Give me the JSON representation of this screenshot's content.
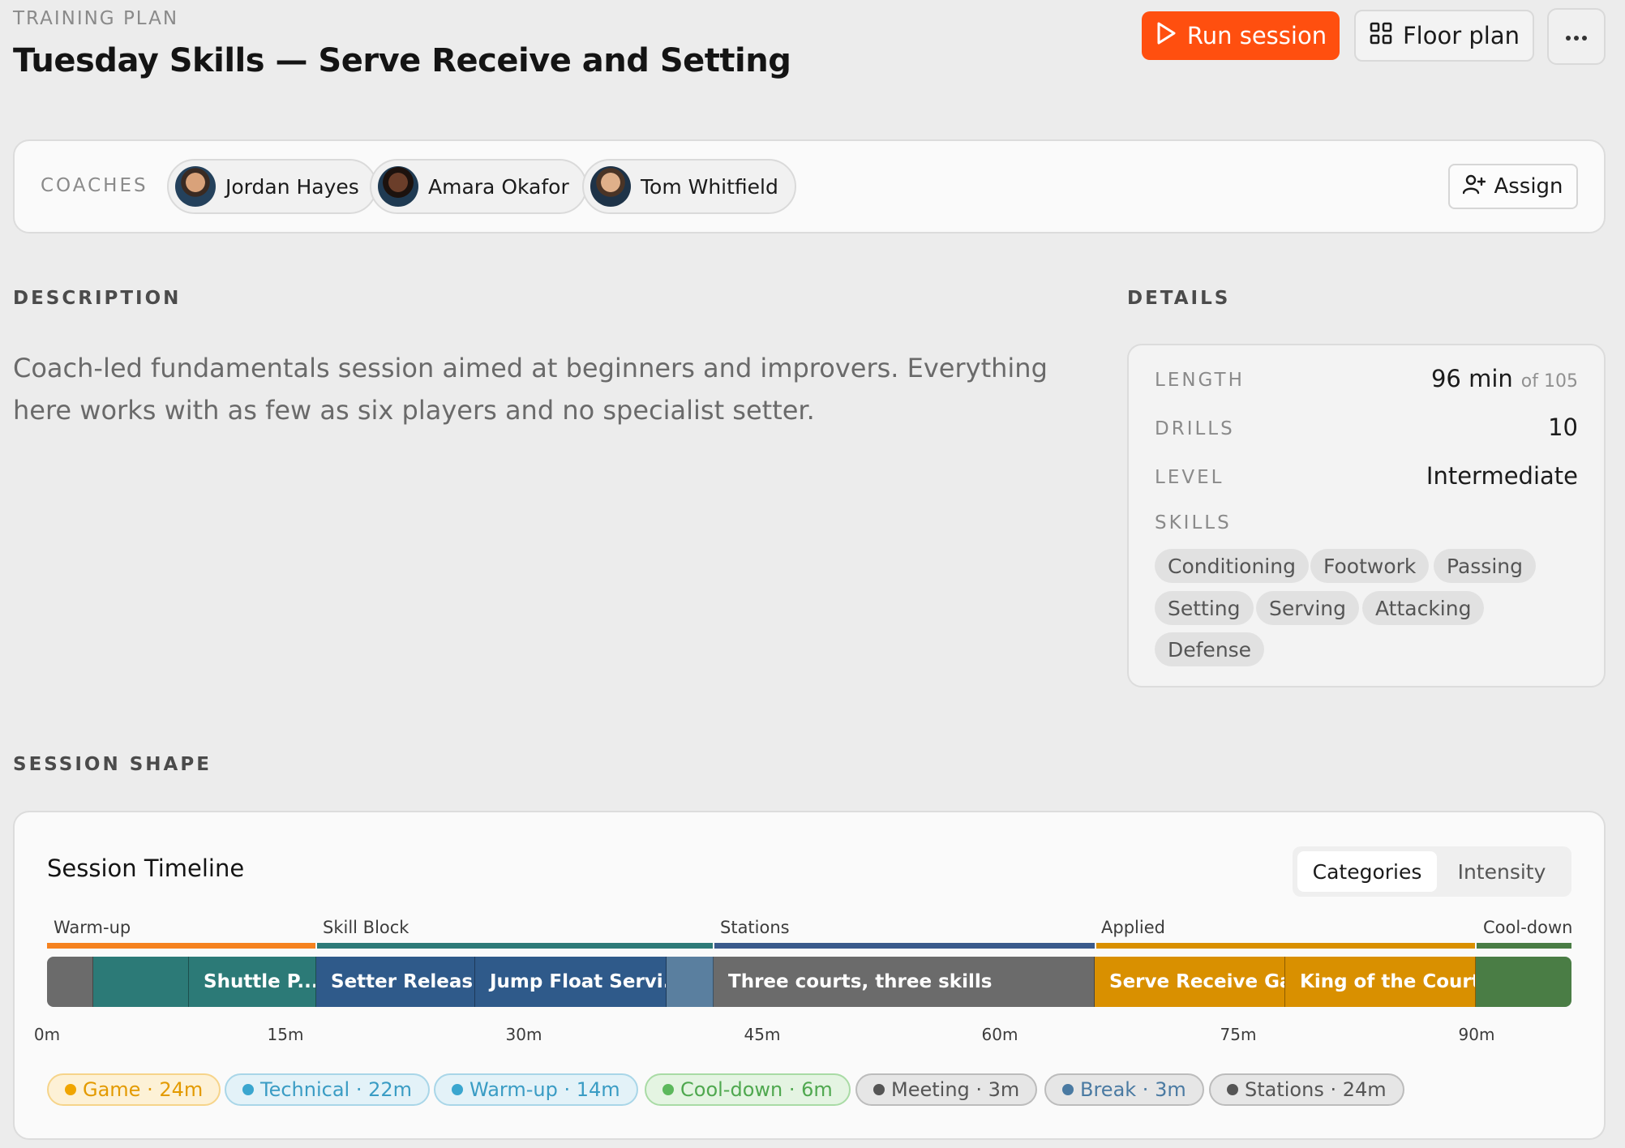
{
  "header": {
    "eyebrow": "TRAINING PLAN",
    "title": "Tuesday Skills — Serve Receive and Setting",
    "run_label": "Run session",
    "floor_label": "Floor plan",
    "more_icon": "more-horizontal-icon"
  },
  "coaches": {
    "label": "COACHES",
    "list": [
      {
        "name": "Jordan Hayes"
      },
      {
        "name": "Amara Okafor"
      },
      {
        "name": "Tom Whitfield"
      }
    ],
    "assign_label": "Assign"
  },
  "description": {
    "label": "DESCRIPTION",
    "text": "Coach-led fundamentals session aimed at beginners and improvers. Everything here works with as few as six players and no specialist setter."
  },
  "details": {
    "label": "DETAILS",
    "length_label": "LENGTH",
    "length_value": "96 min",
    "length_of": "of 105",
    "drills_label": "DRILLS",
    "drills_value": "10",
    "level_label": "LEVEL",
    "level_value": "Intermediate",
    "skills_label": "SKILLS",
    "skills": [
      "Conditioning",
      "Footwork",
      "Passing",
      "Setting",
      "Serving",
      "Attacking",
      "Defense"
    ]
  },
  "session_shape": {
    "label": "SESSION SHAPE",
    "timeline_title": "Session Timeline",
    "toggle": [
      "Categories",
      "Intensity"
    ],
    "active_toggle": "Categories",
    "phases": [
      {
        "label": "Warm-up",
        "color": "#f5821f"
      },
      {
        "label": "Skill Block",
        "color": "#2e7a78"
      },
      {
        "label": "Stations",
        "color": "#3a5a8c"
      },
      {
        "label": "Applied",
        "color": "#d99000"
      },
      {
        "label": "Cool-down",
        "color": "#4a7d45"
      }
    ],
    "segments": [
      {
        "label": "",
        "color": "#6b6b6b"
      },
      {
        "label": "",
        "color": "#2c7a77"
      },
      {
        "label": "Shuttle P...",
        "color": "#2c7a77"
      },
      {
        "label": "Setter Releas...",
        "color": "#2f5a8a"
      },
      {
        "label": "Jump Float Servi...",
        "color": "#2f5a8a"
      },
      {
        "label": "",
        "color": "#5a7f9f"
      },
      {
        "label": "Three courts, three skills",
        "color": "#6b6b6b"
      },
      {
        "label": "Serve Receive Ga...",
        "color": "#d99000"
      },
      {
        "label": "King of the Court",
        "color": "#d99000"
      },
      {
        "label": "",
        "color": "#4a7d45"
      }
    ],
    "ticks": [
      "0m",
      "15m",
      "30m",
      "45m",
      "60m",
      "75m",
      "90m"
    ],
    "legend": [
      {
        "label": "Game · 24m",
        "color": "#f0a500",
        "bg": "#fdf1d6",
        "border": "#f6d48a",
        "text": "#e39a00"
      },
      {
        "label": "Technical · 22m",
        "color": "#3aa6cf",
        "bg": "#e3f2f8",
        "border": "#a9d6e8",
        "text": "#3a9cc4"
      },
      {
        "label": "Warm-up · 14m",
        "color": "#3aa6cf",
        "bg": "#e3f2f8",
        "border": "#a9d6e8",
        "text": "#3a9cc4"
      },
      {
        "label": "Cool-down · 6m",
        "color": "#5cb85c",
        "bg": "#e4f4e2",
        "border": "#a9dba5",
        "text": "#4fa84f"
      },
      {
        "label": "Meeting · 3m",
        "color": "#555555",
        "bg": "#e6e6e6",
        "border": "#bcbcbc",
        "text": "#555555"
      },
      {
        "label": "Break · 3m",
        "color": "#4a7aa2",
        "bg": "#e6e6e6",
        "border": "#bcbcbc",
        "text": "#4a7aa2"
      },
      {
        "label": "Stations · 24m",
        "color": "#555555",
        "bg": "#e6e6e6",
        "border": "#bcbcbc",
        "text": "#555555"
      }
    ]
  }
}
